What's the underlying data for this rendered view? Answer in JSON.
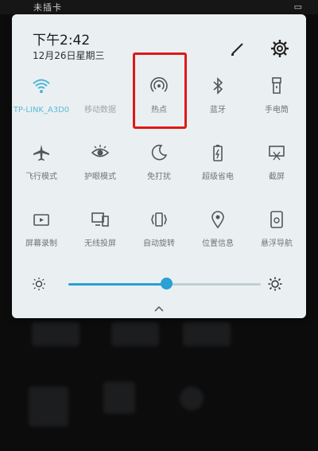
{
  "status_bar": {
    "carrier": "未插卡"
  },
  "header": {
    "time": "下午2:42",
    "date": "12月26日星期三"
  },
  "tiles": [
    {
      "label": "TP-LINK_A3D0",
      "active": true
    },
    {
      "label": "移动数据",
      "active": false
    },
    {
      "label": "热点",
      "active": false
    },
    {
      "label": "蓝牙",
      "active": false
    },
    {
      "label": "手电筒",
      "active": false
    },
    {
      "label": "飞行模式",
      "active": false
    },
    {
      "label": "护眼模式",
      "active": false
    },
    {
      "label": "免打扰",
      "active": false
    },
    {
      "label": "超级省电",
      "active": false
    },
    {
      "label": "截屏",
      "active": false
    },
    {
      "label": "屏幕录制",
      "active": false
    },
    {
      "label": "无线投屏",
      "active": false
    },
    {
      "label": "自动旋转",
      "active": false
    },
    {
      "label": "位置信息",
      "active": false
    },
    {
      "label": "悬浮导航",
      "active": false
    }
  ],
  "brightness": {
    "level_percent": 51
  },
  "colors": {
    "accent": "#2aa0d6",
    "highlight": "#e01818"
  }
}
